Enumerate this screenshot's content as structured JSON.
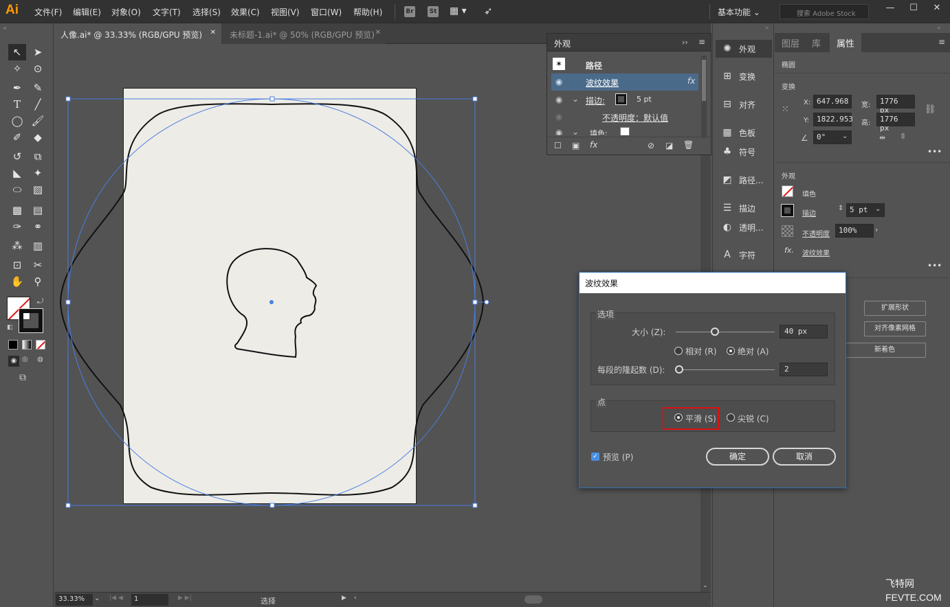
{
  "app": {
    "logo": "Ai",
    "accent": "#ff9a00"
  },
  "menu": [
    "文件(F)",
    "编辑(E)",
    "对象(O)",
    "文字(T)",
    "选择(S)",
    "效果(C)",
    "视图(V)",
    "窗口(W)",
    "帮助(H)"
  ],
  "bridge": {
    "br": "Br",
    "st": "St"
  },
  "workspace": {
    "label": "基本功能"
  },
  "stock": {
    "placeholder": "搜索 Adobe Stock"
  },
  "tabs": {
    "active": "人像.ai* @ 33.33% (RGB/GPU 预览)",
    "inactive": "未标题-1.ai* @ 50% (RGB/GPU 预览)",
    "close": "✕"
  },
  "status": {
    "zoom": "33.33%",
    "page": "1",
    "mode": "选择"
  },
  "appearance": {
    "title": "外观",
    "path_label": "路径",
    "effect": "波纹效果",
    "stroke_label": "描边:",
    "stroke_value": "5 pt",
    "opacity": "不透明度：默认值",
    "fill_label": "填色:",
    "fx": "fx"
  },
  "icon_column": [
    {
      "icon": "✺",
      "label": "外观"
    },
    {
      "icon": "⊞",
      "label": "变换"
    },
    {
      "icon": "⊟",
      "label": "对齐"
    },
    {
      "icon": "▦",
      "label": "色板"
    },
    {
      "icon": "♣",
      "label": "符号"
    },
    {
      "icon": "◩",
      "label": "路径..."
    },
    {
      "icon": "☰",
      "label": "描边"
    },
    {
      "icon": "◐",
      "label": "透明..."
    },
    {
      "icon": "A",
      "label": "字符"
    }
  ],
  "props": {
    "tabs": [
      "图层",
      "库",
      "属性"
    ],
    "shape": "椭圆",
    "transform_title": "变换",
    "x_label": "X:",
    "x": "647.968",
    "y_label": "Y:",
    "y": "1822.953",
    "w_label": "宽:",
    "w": "1776 px",
    "h_label": "高:",
    "h": "1776 px",
    "angle": "0°",
    "appearance_title": "外观",
    "fill": "填色",
    "stroke": "描边",
    "stroke_weight": "5 pt",
    "opacity_label": "不透明度",
    "opacity": "100%",
    "effect": "波纹效果",
    "expand_shape": "扩展形状",
    "pixel_grid": "对齐像素网格",
    "recolor": "新着色"
  },
  "dialog": {
    "title": "波纹效果",
    "options_title": "选项",
    "size_label": "大小 (Z):",
    "size_value": "40 px",
    "relative": "相对 (R)",
    "absolute": "绝对 (A)",
    "ridges_label": "每段的隆起数 (D):",
    "ridges_value": "2",
    "point_title": "点",
    "smooth": "平滑 (S)",
    "corner": "尖锐 (C)",
    "preview": "预览 (P)",
    "ok": "确定",
    "cancel": "取消"
  },
  "watermark": {
    "cn": "飞特网",
    "en": "FEVTE.COM"
  },
  "colors": {
    "selection": "#4a7ee0",
    "highlight": "#e01010",
    "dialog_border": "#2b6eb8"
  }
}
